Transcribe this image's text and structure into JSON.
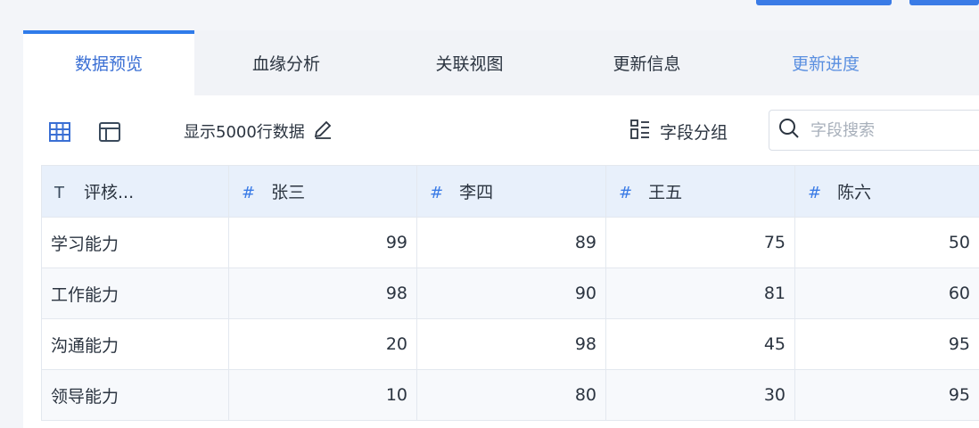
{
  "tabs": [
    {
      "label": "数据预览",
      "active": true
    },
    {
      "label": "血缘分析",
      "active": false
    },
    {
      "label": "关联视图",
      "active": false
    },
    {
      "label": "更新信息",
      "active": false
    },
    {
      "label": "更新进度",
      "active": false
    }
  ],
  "toolbar": {
    "rows_label": "显示5000行数据",
    "group_label": "字段分组",
    "search_placeholder": "字段搜索",
    "icons": [
      "grid-icon",
      "layout-icon",
      "edit-icon",
      "field-group-icon",
      "search-icon"
    ]
  },
  "table": {
    "columns": [
      {
        "type_icon": "T",
        "name": "评核..."
      },
      {
        "type_icon": "#",
        "name": "张三"
      },
      {
        "type_icon": "#",
        "name": "李四"
      },
      {
        "type_icon": "#",
        "name": "王五"
      },
      {
        "type_icon": "#",
        "name": "陈六"
      }
    ],
    "rows": [
      {
        "label": "学习能力",
        "values": [
          "99",
          "89",
          "75",
          "50"
        ]
      },
      {
        "label": "工作能力",
        "values": [
          "98",
          "90",
          "81",
          "60"
        ]
      },
      {
        "label": "沟通能力",
        "values": [
          "20",
          "98",
          "45",
          "95"
        ]
      },
      {
        "label": "领导能力",
        "values": [
          "10",
          "80",
          "30",
          "95"
        ]
      }
    ]
  },
  "colors": {
    "accent": "#2f7bea",
    "header_bg": "#e8f0fb",
    "tab_bar_bg": "#f1f3f7"
  }
}
